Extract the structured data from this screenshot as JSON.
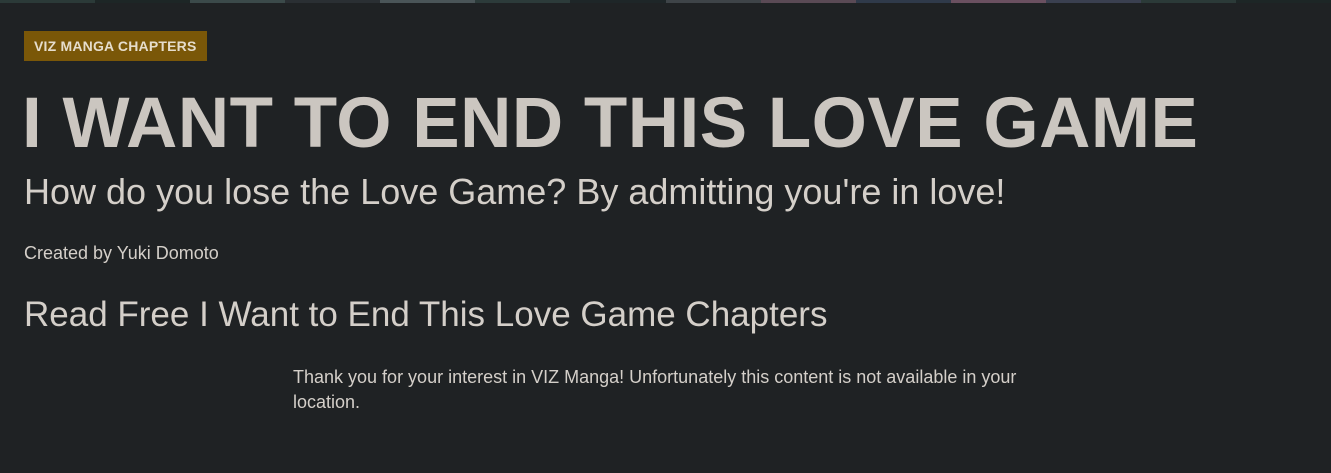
{
  "header": {
    "badge_label": "VIZ MANGA CHAPTERS",
    "title": "I WANT TO END THIS LOVE GAME",
    "subtitle": "How do you lose the Love Game? By admitting you're in love!",
    "creator": "Created by Yuki Domoto"
  },
  "chapters_section": {
    "heading": "Read Free I Want to End This Love Game Chapters",
    "notice": "Thank you for your interest in VIZ Manga! Unfortunately this content is not available in your location."
  },
  "colors": {
    "page_background": "#1f2224",
    "badge_background": "#7a5708",
    "title_text": "#cbc6c0",
    "body_text": "#d4cfc9"
  }
}
